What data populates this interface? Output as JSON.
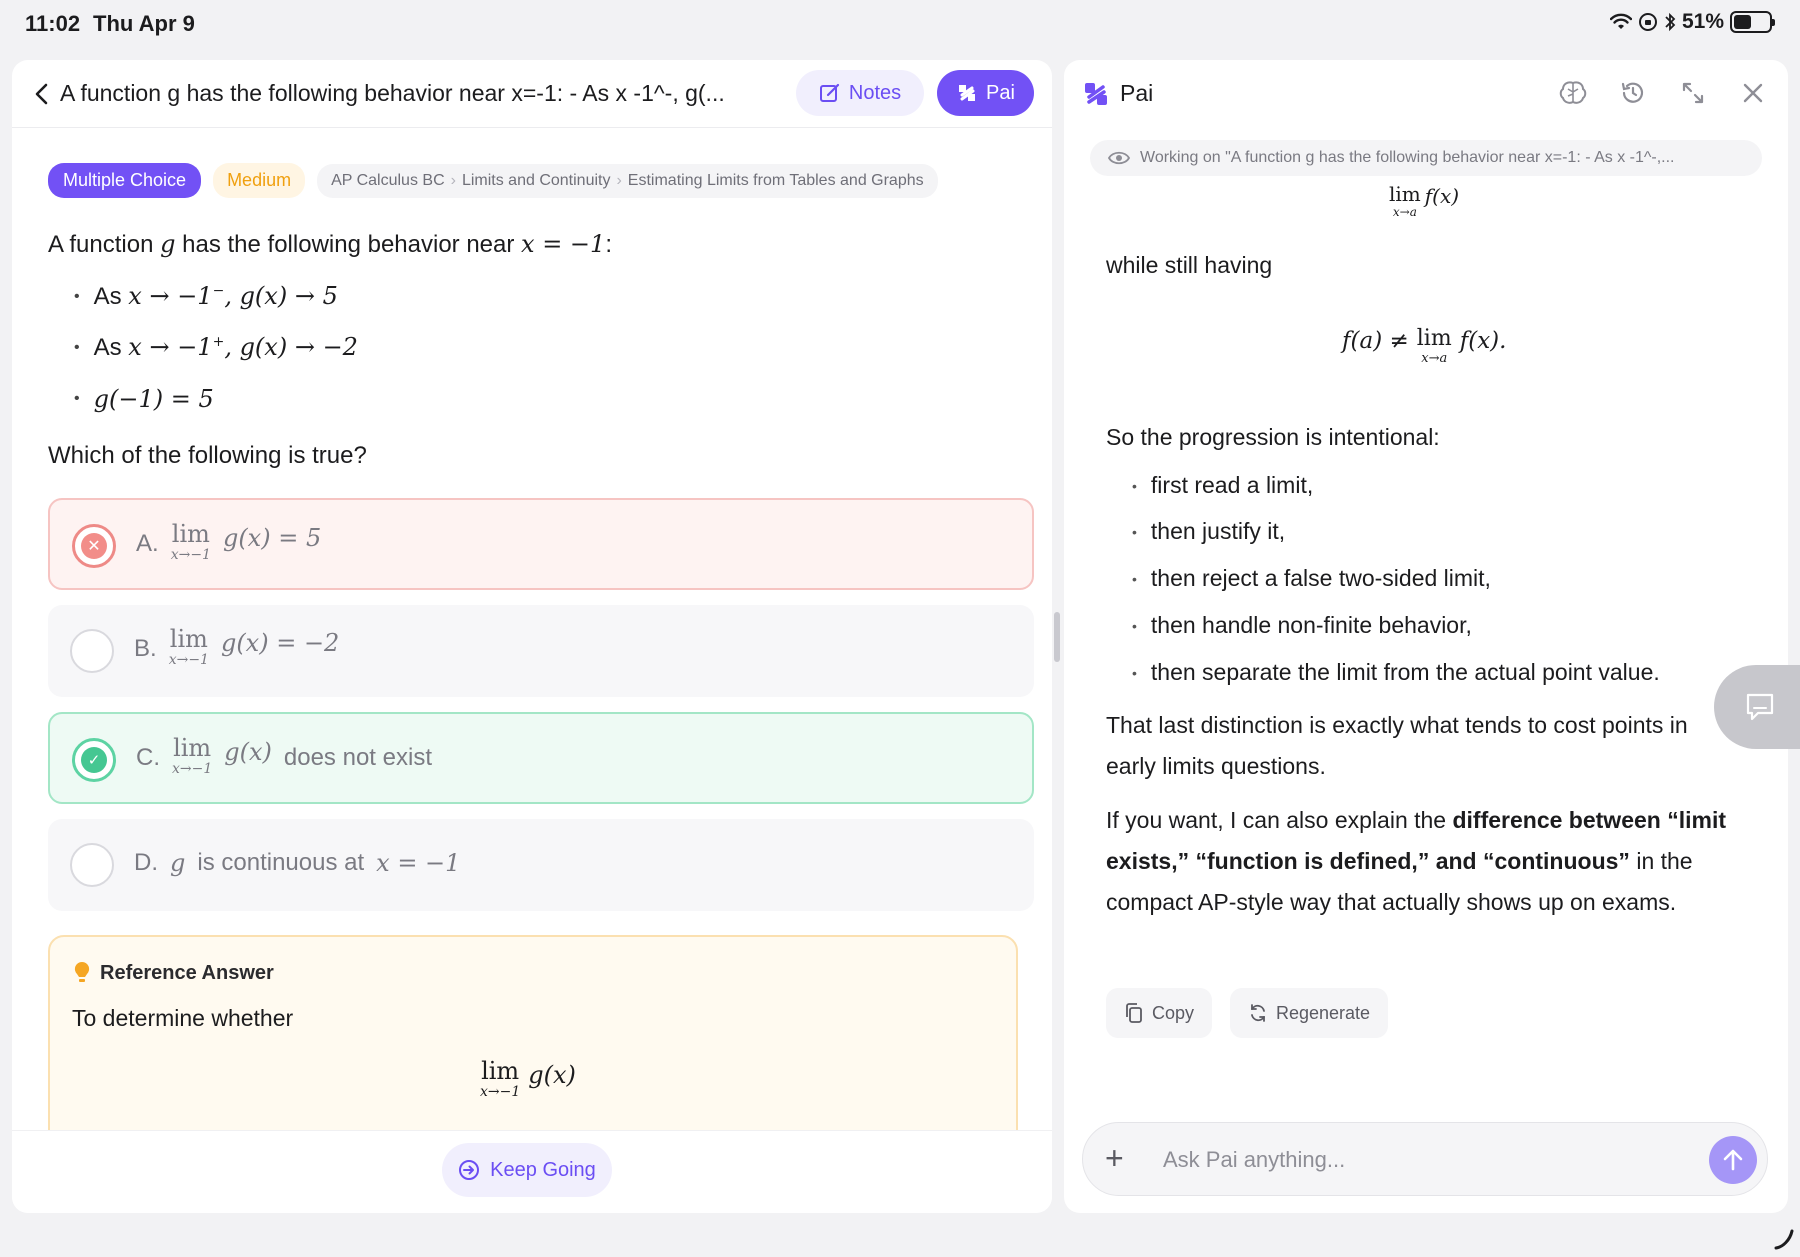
{
  "status_bar": {
    "time": "11:02",
    "date": "Thu Apr 9",
    "battery": "51%",
    "battery_level": 0.51
  },
  "question_panel": {
    "header": {
      "title": "A function g has the following behavior near x=-1: - As x -1^-, g(...",
      "notes_label": "Notes",
      "pai_label": "Pai"
    },
    "tags": {
      "type": "Multiple Choice",
      "difficulty": "Medium",
      "breadcrumbs": [
        "AP Calculus BC",
        "Limits and Continuity",
        "Estimating Limits from Tables and Graphs"
      ]
    },
    "stem": {
      "intro_pre": "A function",
      "intro_var": "g",
      "intro_mid": "has the following behavior near",
      "intro_math": "x = −1",
      "intro_post": ":",
      "bullets": [
        {
          "pre": "As",
          "math": "x → −1",
          "sup": "−",
          "post_math": ", g(x) → 5"
        },
        {
          "pre": "As",
          "math": "x → −1",
          "sup": "+",
          "post_math": ", g(x) → −2"
        },
        {
          "pre": "",
          "math": "g(−1) = 5",
          "sup": "",
          "post_math": ""
        }
      ],
      "prompt": "Which of the following is true?"
    },
    "options": [
      {
        "letter": "A.",
        "lim": "lim",
        "sub": "x→−1",
        "expr": "g(x) = 5",
        "text": "",
        "state": "wrong"
      },
      {
        "letter": "B.",
        "lim": "lim",
        "sub": "x→−1",
        "expr": "g(x) = −2",
        "text": "",
        "state": "none"
      },
      {
        "letter": "C.",
        "lim": "lim",
        "sub": "x→−1",
        "expr": "g(x)",
        "text": "does not exist",
        "state": "correct"
      },
      {
        "letter": "D.",
        "var": "g",
        "text": "is continuous at",
        "math": "x = −1",
        "state": "none"
      }
    ],
    "reference": {
      "title": "Reference Answer",
      "text": "To determine whether",
      "lim": "lim",
      "sub": "x→−1",
      "expr": "g(x)"
    },
    "keep_going_label": "Keep Going"
  },
  "pai_panel": {
    "title": "Pai",
    "working_on": "Working on \"A function g has the following behavior near x=-1: - As x -1^-,...",
    "top_formula": {
      "lim": "lim",
      "sub": "x→a",
      "expr": "f(x)"
    },
    "while_text": "while still having",
    "center_formula": {
      "pre": "f(a) ≠",
      "lim": "lim",
      "sub": "x→a",
      "post": "f(x)."
    },
    "progression_intro": "So the progression is intentional:",
    "progression": [
      "first read a limit,",
      "then justify it,",
      "then reject a false two-sided limit,",
      "then handle non-finite behavior,",
      "then separate the limit from the actual point value."
    ],
    "distinction_text": "That last distinction is exactly what tends to cost points in early limits questions.",
    "offer": {
      "pre": "If you want, I can also explain the",
      "bold": "difference between “limit exists,” “function is defined,” and “continuous”",
      "post": "in the compact AP-style way that actually shows up on exams."
    },
    "copy_label": "Copy",
    "regenerate_label": "Regenerate",
    "ask_placeholder": "Ask Pai anything..."
  },
  "colors": {
    "accent": "#7251f5",
    "wrong": "#f28d89",
    "correct": "#45c792",
    "medium": "#f0a010"
  }
}
